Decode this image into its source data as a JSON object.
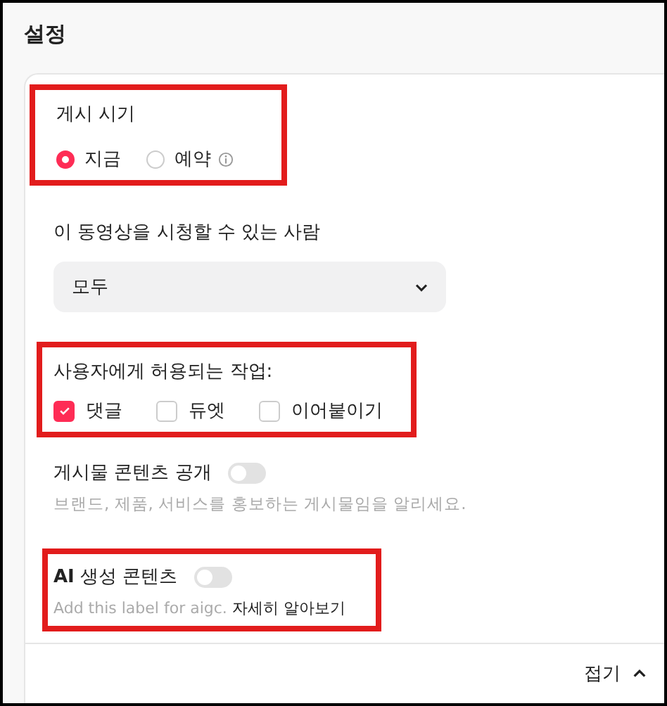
{
  "title": "설정",
  "post_timing": {
    "label": "게시 시기",
    "highlighted": true,
    "options": [
      {
        "label": "지금",
        "selected": true
      },
      {
        "label": "예약",
        "selected": false,
        "info": true
      }
    ]
  },
  "audience": {
    "label": "이 동영상을 시청할 수 있는 사람",
    "highlighted": false,
    "value": "모두"
  },
  "allowed_actions": {
    "label": "사용자에게 허용되는 작업:",
    "highlighted": true,
    "options": [
      {
        "label": "댓글",
        "checked": true
      },
      {
        "label": "듀엣",
        "checked": false
      },
      {
        "label": "이어붙이기",
        "checked": false
      }
    ]
  },
  "content_disclosure": {
    "label": "게시물 콘텐츠 공개",
    "highlighted": false,
    "on": false,
    "description": "브랜드, 제품, 서비스를 홍보하는 게시물임을 알리세요."
  },
  "ai_content": {
    "label": "**AI** 생성 콘텐츠",
    "highlighted": true,
    "on": false,
    "description": "Add this label for aigc.",
    "link": "자세히 알아보기"
  },
  "collapse": {
    "label": "접기"
  }
}
